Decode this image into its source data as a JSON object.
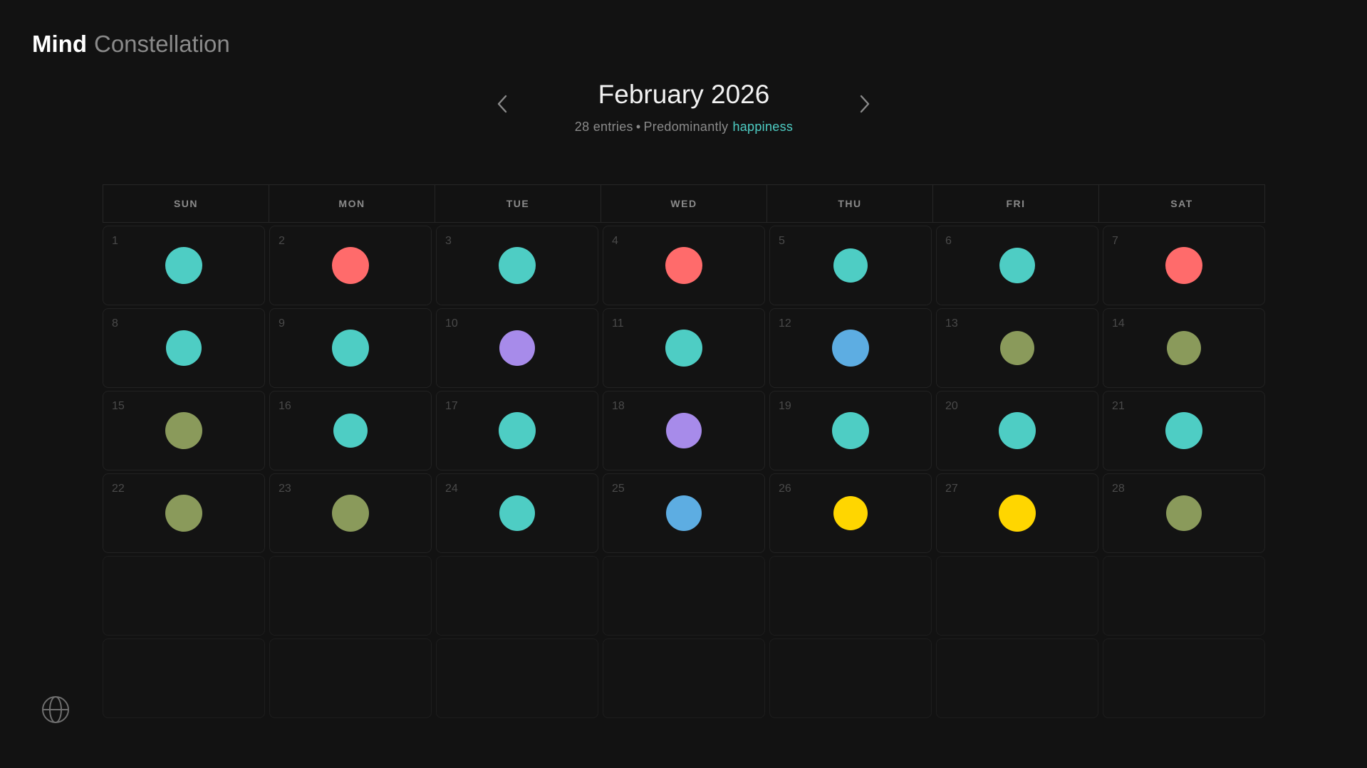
{
  "brand": {
    "bold": "Mind",
    "light": "Constellation"
  },
  "header": {
    "month_title": "February 2026",
    "entries": "28 entries",
    "separator": "•",
    "predominant_label": "Predominantly",
    "predominant_mood": "happiness",
    "prev_icon": "chevron-left-icon",
    "next_icon": "chevron-right-icon"
  },
  "colors": {
    "background": "#121212",
    "teal": "#4ecdc4",
    "coral": "#ff6b6b",
    "purple": "#a78bea",
    "blue": "#5dade2",
    "olive": "#8a9a5b",
    "yellow": "#ffd600"
  },
  "calendar": {
    "weekdays": [
      "SUN",
      "MON",
      "TUE",
      "WED",
      "THU",
      "FRI",
      "SAT"
    ],
    "days": [
      {
        "day": "1",
        "color": "#4ecdc4",
        "size": 52
      },
      {
        "day": "2",
        "color": "#ff6b6b",
        "size": 52
      },
      {
        "day": "3",
        "color": "#4ecdc4",
        "size": 52
      },
      {
        "day": "4",
        "color": "#ff6b6b",
        "size": 52
      },
      {
        "day": "5",
        "color": "#4ecdc4",
        "size": 48
      },
      {
        "day": "6",
        "color": "#4ecdc4",
        "size": 50
      },
      {
        "day": "7",
        "color": "#ff6b6b",
        "size": 52
      },
      {
        "day": "8",
        "color": "#4ecdc4",
        "size": 50
      },
      {
        "day": "9",
        "color": "#4ecdc4",
        "size": 52
      },
      {
        "day": "10",
        "color": "#a78bea",
        "size": 50
      },
      {
        "day": "11",
        "color": "#4ecdc4",
        "size": 52
      },
      {
        "day": "12",
        "color": "#5dade2",
        "size": 52
      },
      {
        "day": "13",
        "color": "#8a9a5b",
        "size": 48
      },
      {
        "day": "14",
        "color": "#8a9a5b",
        "size": 48
      },
      {
        "day": "15",
        "color": "#8a9a5b",
        "size": 52
      },
      {
        "day": "16",
        "color": "#4ecdc4",
        "size": 48
      },
      {
        "day": "17",
        "color": "#4ecdc4",
        "size": 52
      },
      {
        "day": "18",
        "color": "#a78bea",
        "size": 50
      },
      {
        "day": "19",
        "color": "#4ecdc4",
        "size": 52
      },
      {
        "day": "20",
        "color": "#4ecdc4",
        "size": 52
      },
      {
        "day": "21",
        "color": "#4ecdc4",
        "size": 52
      },
      {
        "day": "22",
        "color": "#8a9a5b",
        "size": 52
      },
      {
        "day": "23",
        "color": "#8a9a5b",
        "size": 52
      },
      {
        "day": "24",
        "color": "#4ecdc4",
        "size": 50
      },
      {
        "day": "25",
        "color": "#5dade2",
        "size": 50
      },
      {
        "day": "26",
        "color": "#ffd600",
        "size": 48
      },
      {
        "day": "27",
        "color": "#ffd600",
        "size": 52
      },
      {
        "day": "28",
        "color": "#8a9a5b",
        "size": 50
      }
    ],
    "empty_cells": 14
  },
  "footer": {
    "language_icon": "globe-icon"
  }
}
